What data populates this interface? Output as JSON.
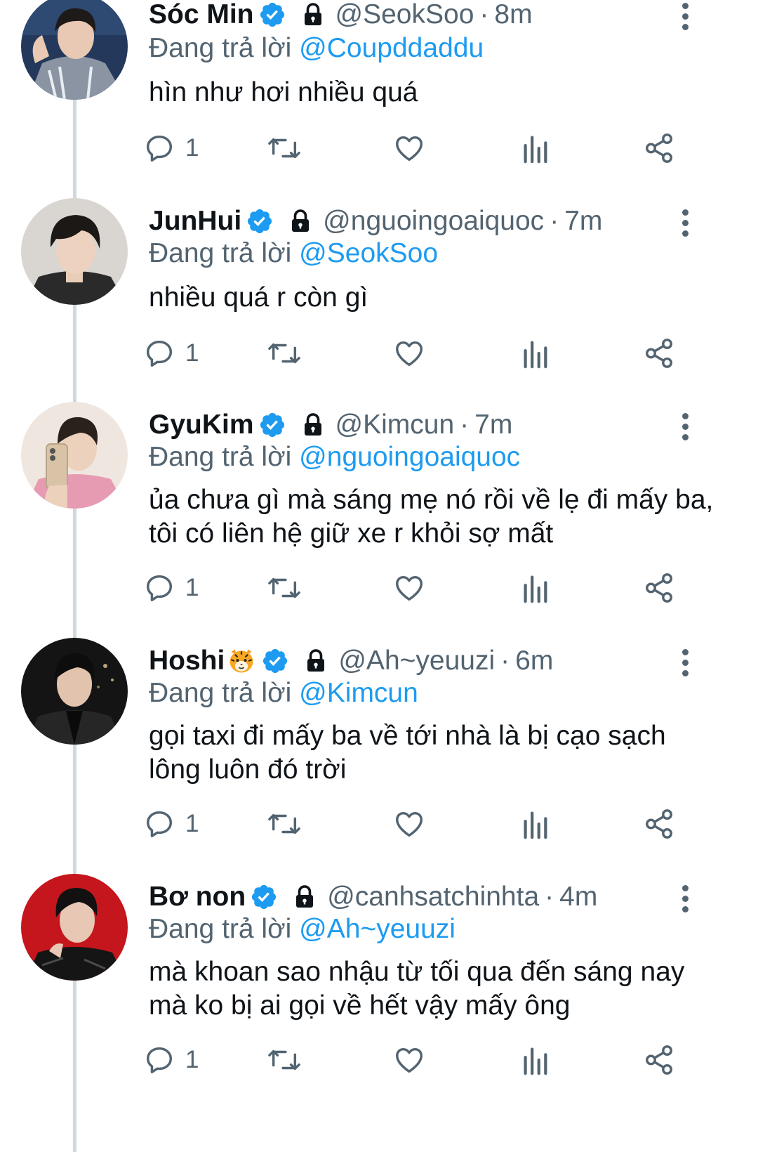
{
  "replying_label": "Đang trả lời",
  "tweets": [
    {
      "name": "Sóc Min",
      "emoji": "",
      "handle": "@SeokSoo",
      "time": "8m",
      "reply_to": "@Coupddaddu",
      "text": "hìn như hơi nhiều quá",
      "reply_count": "1"
    },
    {
      "name": "JunHui",
      "emoji": "",
      "handle": "@nguoingoaiquoc",
      "time": "7m",
      "reply_to": "@SeokSoo",
      "text": "nhiều quá r còn gì",
      "reply_count": "1"
    },
    {
      "name": "GyuKim",
      "emoji": "",
      "handle": "@Kimcun",
      "time": "7m",
      "reply_to": "@nguoingoaiquoc",
      "text": "ủa chưa gì mà sáng mẹ nó rồi về lẹ đi mấy ba, tôi có liên hệ giữ xe r khỏi sợ mất",
      "reply_count": "1"
    },
    {
      "name": "Hoshi",
      "emoji": "tiger-face",
      "handle": "@Ah~yeuuzi",
      "time": "6m",
      "reply_to": "@Kimcun",
      "text": "gọi taxi đi mấy ba về tới nhà là bị cạo sạch lông luôn đó trời",
      "reply_count": "1"
    },
    {
      "name": "Bơ non",
      "emoji": "",
      "handle": "@canhsatchinhta",
      "time": "4m",
      "reply_to": "@Ah~yeuuzi",
      "text": "mà khoan sao nhậu từ tối qua đến sáng nay mà ko bị ai gọi về hết vậy mấy ông",
      "reply_count": "1"
    }
  ],
  "colors": {
    "verified": "#1d9bf0",
    "mention": "#1d9bf0",
    "secondary_text": "#536471",
    "thread_line": "#cfd9de"
  }
}
